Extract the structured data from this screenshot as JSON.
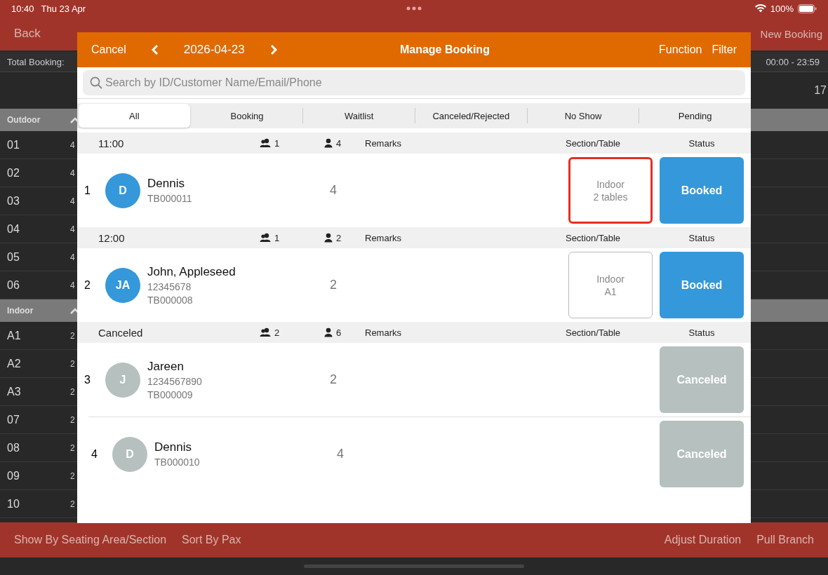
{
  "status_bar": {
    "time": "10:40",
    "date": "Thu 23 Apr",
    "battery": "100%"
  },
  "background": {
    "nav": {
      "back": "Back",
      "right_action": "New Booking"
    },
    "summary": {
      "label": "Total Booking:",
      "time_range": "00:00 - 23:59"
    },
    "hour_label": "17",
    "sections": [
      {
        "name": "Outdoor",
        "tables": [
          {
            "name": "01",
            "capacity": "4"
          },
          {
            "name": "02",
            "capacity": "4"
          },
          {
            "name": "03",
            "capacity": "4"
          },
          {
            "name": "04",
            "capacity": "4"
          },
          {
            "name": "05",
            "capacity": "4"
          },
          {
            "name": "06",
            "capacity": "4"
          }
        ]
      },
      {
        "name": "Indoor",
        "tables": [
          {
            "name": "A1",
            "capacity": "2"
          },
          {
            "name": "A2",
            "capacity": "2"
          },
          {
            "name": "A3",
            "capacity": "2"
          },
          {
            "name": "07",
            "capacity": "2"
          },
          {
            "name": "08",
            "capacity": "2"
          },
          {
            "name": "09",
            "capacity": "2"
          },
          {
            "name": "10",
            "capacity": "2"
          }
        ]
      }
    ],
    "bottom_bar": [
      "Show By Seating Area/Section",
      "Sort By Pax",
      "Adjust Duration",
      "Pull Branch"
    ]
  },
  "modal": {
    "header": {
      "cancel": "Cancel",
      "date": "2026-04-23",
      "title": "Manage Booking",
      "actions": [
        "Function",
        "Filter"
      ]
    },
    "search": {
      "placeholder": "Search by ID/Customer Name/Email/Phone"
    },
    "tabs": [
      {
        "label": "All",
        "selected": true
      },
      {
        "label": "Booking",
        "selected": false
      },
      {
        "label": "Waitlist",
        "selected": false
      },
      {
        "label": "Canceled/Rejected",
        "selected": false
      },
      {
        "label": "No Show",
        "selected": false
      },
      {
        "label": "Pending",
        "selected": false
      }
    ],
    "groups": [
      {
        "title": "11:00",
        "parties": "1",
        "guests": "4",
        "remarks": "Remarks",
        "section_table": "Section/Table",
        "status": "Status",
        "bookings": [
          {
            "index": "1",
            "initials": "D",
            "name": "Dennis",
            "booking_id": "TB000011",
            "pax": "4",
            "section": "Indoor",
            "table": "2 tables",
            "highlighted": true,
            "status": "Booked",
            "kind": "booked"
          }
        ]
      },
      {
        "title": "12:00",
        "parties": "1",
        "guests": "2",
        "remarks": "Remarks",
        "section_table": "Section/Table",
        "status": "Status",
        "bookings": [
          {
            "index": "2",
            "initials": "JA",
            "name": "John, Appleseed",
            "phone": "12345678",
            "booking_id": "TB000008",
            "pax": "2",
            "section": "Indoor",
            "table": "A1",
            "highlighted": false,
            "status": "Booked",
            "kind": "booked"
          }
        ]
      },
      {
        "title": "Canceled",
        "parties": "2",
        "guests": "6",
        "remarks": "Remarks",
        "section_table": "Section/Table",
        "status": "Status",
        "bookings": [
          {
            "index": "3",
            "initials": "J",
            "name": "Jareen",
            "phone": "1234567890",
            "booking_id": "TB000009",
            "pax": "2",
            "status": "Canceled",
            "kind": "canceled"
          },
          {
            "index": "4",
            "initials": "D",
            "name": "Dennis",
            "booking_id": "TB000010",
            "pax": "4",
            "status": "Canceled",
            "kind": "canceled"
          }
        ]
      }
    ]
  }
}
